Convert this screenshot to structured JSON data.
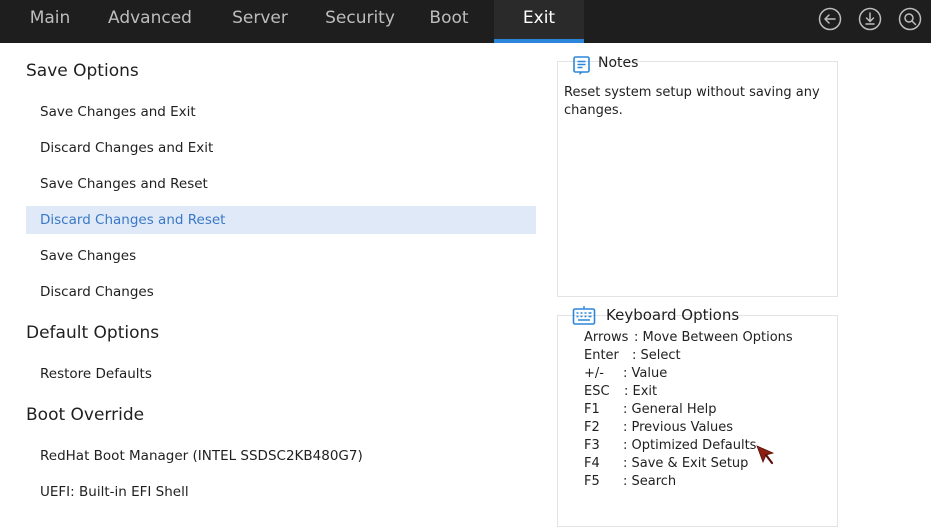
{
  "nav": {
    "tabs": [
      {
        "label": "Main",
        "active": false
      },
      {
        "label": "Advanced",
        "active": false
      },
      {
        "label": "Server",
        "active": false
      },
      {
        "label": "Security",
        "active": false
      },
      {
        "label": "Boot",
        "active": false
      },
      {
        "label": "Exit",
        "active": true
      }
    ],
    "icons": [
      "back-icon",
      "download-icon",
      "search-icon"
    ]
  },
  "sections": {
    "save_options": {
      "title": "Save Options",
      "items": [
        "Save Changes and Exit",
        "Discard Changes and Exit",
        "Save Changes and Reset",
        "Discard Changes and Reset",
        "Save Changes",
        "Discard Changes"
      ],
      "selected_index": 3
    },
    "default_options": {
      "title": "Default Options",
      "items": [
        "Restore Defaults"
      ]
    },
    "boot_override": {
      "title": "Boot Override",
      "items": [
        "RedHat Boot Manager (INTEL SSDSC2KB480G7)",
        "UEFI: Built-in EFI Shell"
      ]
    }
  },
  "notes": {
    "title": "Notes",
    "text": "Reset system setup without saving any changes."
  },
  "keyboard": {
    "title": "Keyboard Options",
    "rows": [
      {
        "key": "Arrows",
        "desc": ": Move Between Options"
      },
      {
        "key": "Enter",
        "desc": ": Select"
      },
      {
        "key": "+/-",
        "desc": ": Value"
      },
      {
        "key": "ESC",
        "desc": ": Exit"
      },
      {
        "key": "F1",
        "desc": ": General Help"
      },
      {
        "key": "F2",
        "desc": ": Previous Values"
      },
      {
        "key": "F3",
        "desc": ": Optimized Defaults"
      },
      {
        "key": "F4",
        "desc": ": Save & Exit Setup"
      },
      {
        "key": "F5",
        "desc": ": Search"
      }
    ]
  },
  "colors": {
    "topbar": "#1e1e1e",
    "accent": "#2b86d9",
    "selected_bg": "#dfe9f7",
    "selected_text": "#3a78c8"
  }
}
